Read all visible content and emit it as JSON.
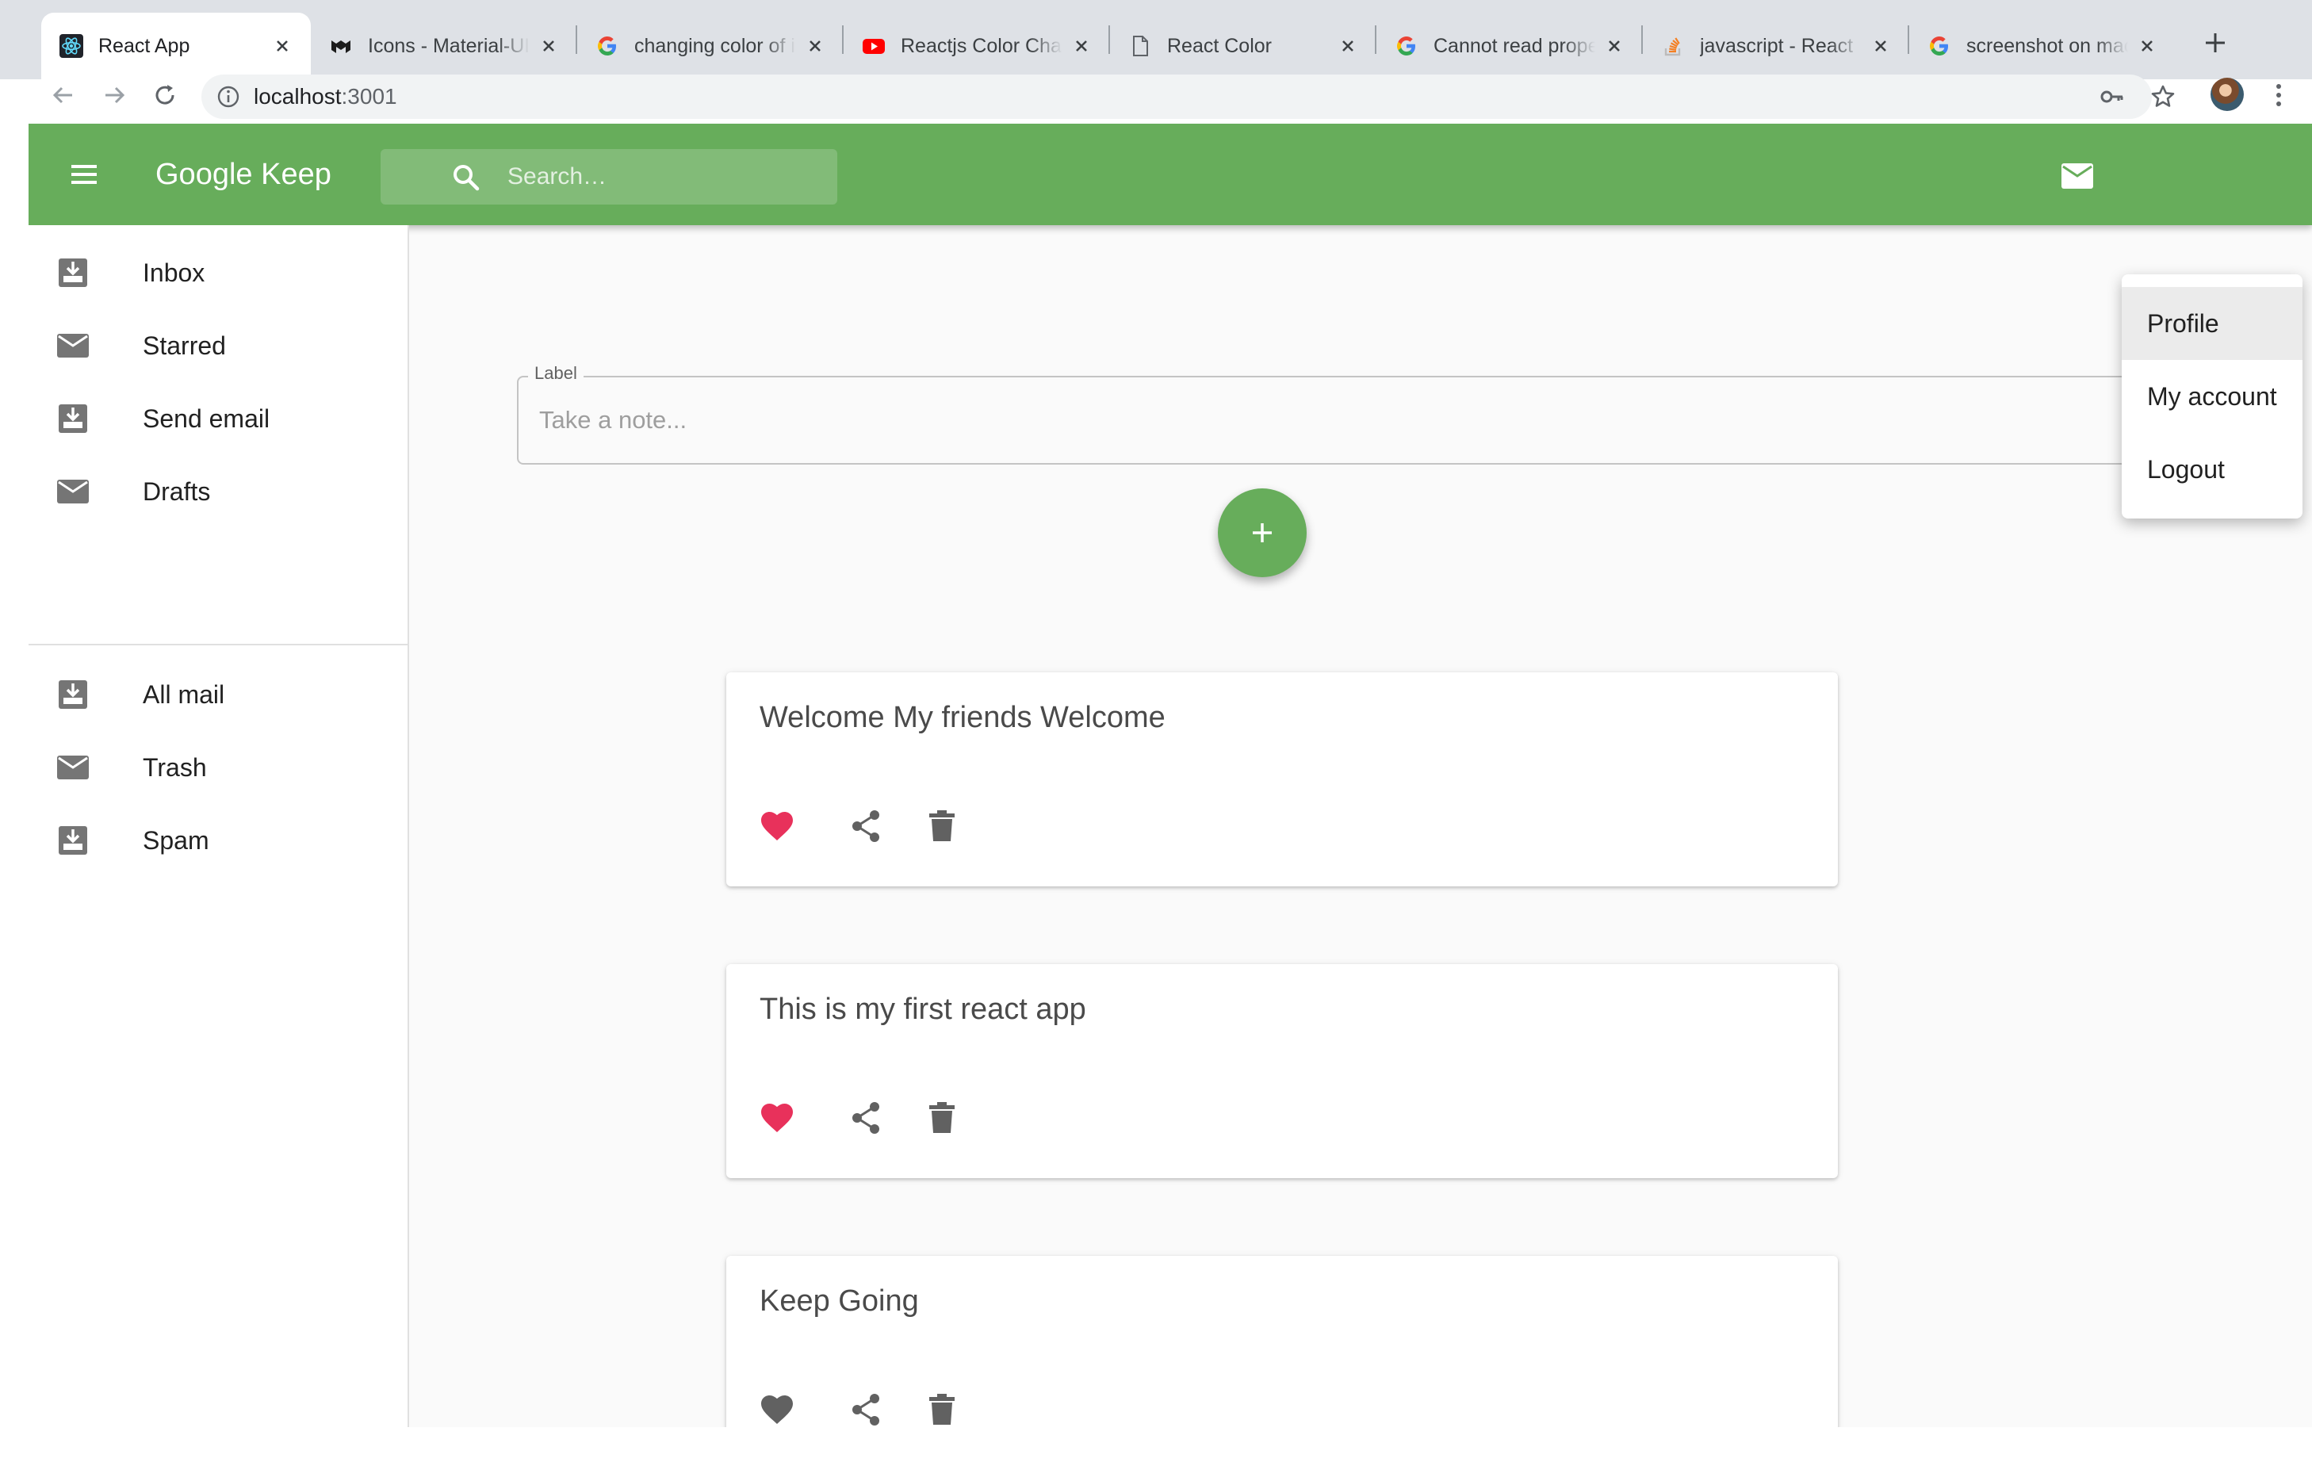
{
  "browser": {
    "tabs": [
      {
        "title": "React App",
        "icon": "react-icon",
        "active": true
      },
      {
        "title": "Icons - Material-UI",
        "icon": "material-ui-icon",
        "active": false
      },
      {
        "title": "changing color of i",
        "icon": "google-icon",
        "active": false
      },
      {
        "title": "Reactjs Color Change",
        "icon": "youtube-icon",
        "active": false
      },
      {
        "title": "React Color",
        "icon": "document-icon",
        "active": false
      },
      {
        "title": "Cannot read property",
        "icon": "google-icon",
        "active": false
      },
      {
        "title": "javascript - React",
        "icon": "stackoverflow-icon",
        "active": false
      },
      {
        "title": "screenshot on mac",
        "icon": "google-icon",
        "active": false
      }
    ],
    "url_host": "localhost",
    "url_port": ":3001"
  },
  "app": {
    "title": "Google Keep",
    "accent_color": "#67ad5b",
    "search_placeholder": "Search…"
  },
  "sidebar": {
    "primary": [
      {
        "label": "Inbox",
        "icon": "move-to-inbox-icon"
      },
      {
        "label": "Starred",
        "icon": "mail-icon"
      },
      {
        "label": "Send email",
        "icon": "move-to-inbox-icon"
      },
      {
        "label": "Drafts",
        "icon": "mail-icon"
      }
    ],
    "secondary": [
      {
        "label": "All mail",
        "icon": "move-to-inbox-icon"
      },
      {
        "label": "Trash",
        "icon": "mail-icon"
      },
      {
        "label": "Spam",
        "icon": "move-to-inbox-icon"
      }
    ]
  },
  "note_input": {
    "label": "Label",
    "placeholder": "Take a note..."
  },
  "notes": [
    {
      "title": "Welcome My friends Welcome",
      "favorited": true
    },
    {
      "title": "This is my first react app",
      "favorited": true
    },
    {
      "title": "Keep Going",
      "favorited": false
    }
  ],
  "account_menu": {
    "items": [
      "Profile",
      "My account",
      "Logout"
    ],
    "highlighted": "Profile"
  },
  "colors": {
    "heart_active": "#e8315b",
    "heart_inactive": "#616161",
    "icon_gray": "#616161"
  }
}
